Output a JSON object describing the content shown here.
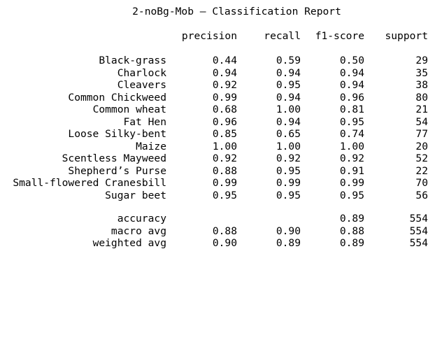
{
  "report": {
    "title": "2-noBg-Mob — Classification Report",
    "headers": {
      "precision": "precision",
      "recall": "recall",
      "f1": "f1-score",
      "support": "support"
    },
    "classes": [
      {
        "label": "Black-grass",
        "precision": "0.44",
        "recall": "0.59",
        "f1": "0.50",
        "support": "29"
      },
      {
        "label": "Charlock",
        "precision": "0.94",
        "recall": "0.94",
        "f1": "0.94",
        "support": "35"
      },
      {
        "label": "Cleavers",
        "precision": "0.92",
        "recall": "0.95",
        "f1": "0.94",
        "support": "38"
      },
      {
        "label": "Common Chickweed",
        "precision": "0.99",
        "recall": "0.94",
        "f1": "0.96",
        "support": "80"
      },
      {
        "label": "Common wheat",
        "precision": "0.68",
        "recall": "1.00",
        "f1": "0.81",
        "support": "21"
      },
      {
        "label": "Fat Hen",
        "precision": "0.96",
        "recall": "0.94",
        "f1": "0.95",
        "support": "54"
      },
      {
        "label": "Loose Silky-bent",
        "precision": "0.85",
        "recall": "0.65",
        "f1": "0.74",
        "support": "77"
      },
      {
        "label": "Maize",
        "precision": "1.00",
        "recall": "1.00",
        "f1": "1.00",
        "support": "20"
      },
      {
        "label": "Scentless Mayweed",
        "precision": "0.92",
        "recall": "0.92",
        "f1": "0.92",
        "support": "52"
      },
      {
        "label": "Shepherd’s Purse",
        "precision": "0.88",
        "recall": "0.95",
        "f1": "0.91",
        "support": "22"
      },
      {
        "label": "Small-flowered Cranesbill",
        "precision": "0.99",
        "recall": "0.99",
        "f1": "0.99",
        "support": "70"
      },
      {
        "label": "Sugar beet",
        "precision": "0.95",
        "recall": "0.95",
        "f1": "0.95",
        "support": "56"
      }
    ],
    "summary": [
      {
        "label": "accuracy",
        "precision": "",
        "recall": "",
        "f1": "0.89",
        "support": "554"
      },
      {
        "label": "macro avg",
        "precision": "0.88",
        "recall": "0.90",
        "f1": "0.88",
        "support": "554"
      },
      {
        "label": "weighted avg",
        "precision": "0.90",
        "recall": "0.89",
        "f1": "0.89",
        "support": "554"
      }
    ]
  }
}
